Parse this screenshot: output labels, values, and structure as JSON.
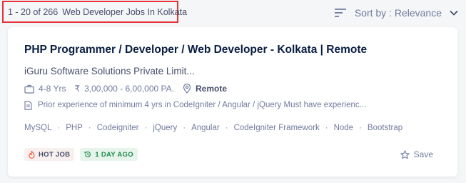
{
  "results": {
    "range": "1 - 20 of 266",
    "label": "Web Developer Jobs In Kolkata"
  },
  "sort": {
    "label": "Sort by : Relevance",
    "icon": "sort-lines-icon"
  },
  "job": {
    "title": "PHP Programmer / Developer / Web Developer - Kolkata | Remote",
    "company": "iGuru Software Solutions Private Limit...",
    "experience": "4-8 Yrs",
    "salary": "3,00,000 - 6,00,000 PA.",
    "location": "Remote",
    "description": "Prior experience of minimum 4 yrs in CodeIgniter / Angular / jQuery Must have experienc...",
    "tags": [
      "MySQL",
      "PHP",
      "Codeigniter",
      "jQuery",
      "Angular",
      "CodeIgniter Framework",
      "Node",
      "Bootstrap"
    ],
    "hot_badge": "HOT JOB",
    "age_badge": "1 DAY AGO",
    "save_label": "Save"
  },
  "colors": {
    "highlight_border": "#e5333b",
    "title": "#091e42",
    "muted": "#717b9e",
    "age_green": "#1f8a4c",
    "hot_orange": "#f05537"
  }
}
